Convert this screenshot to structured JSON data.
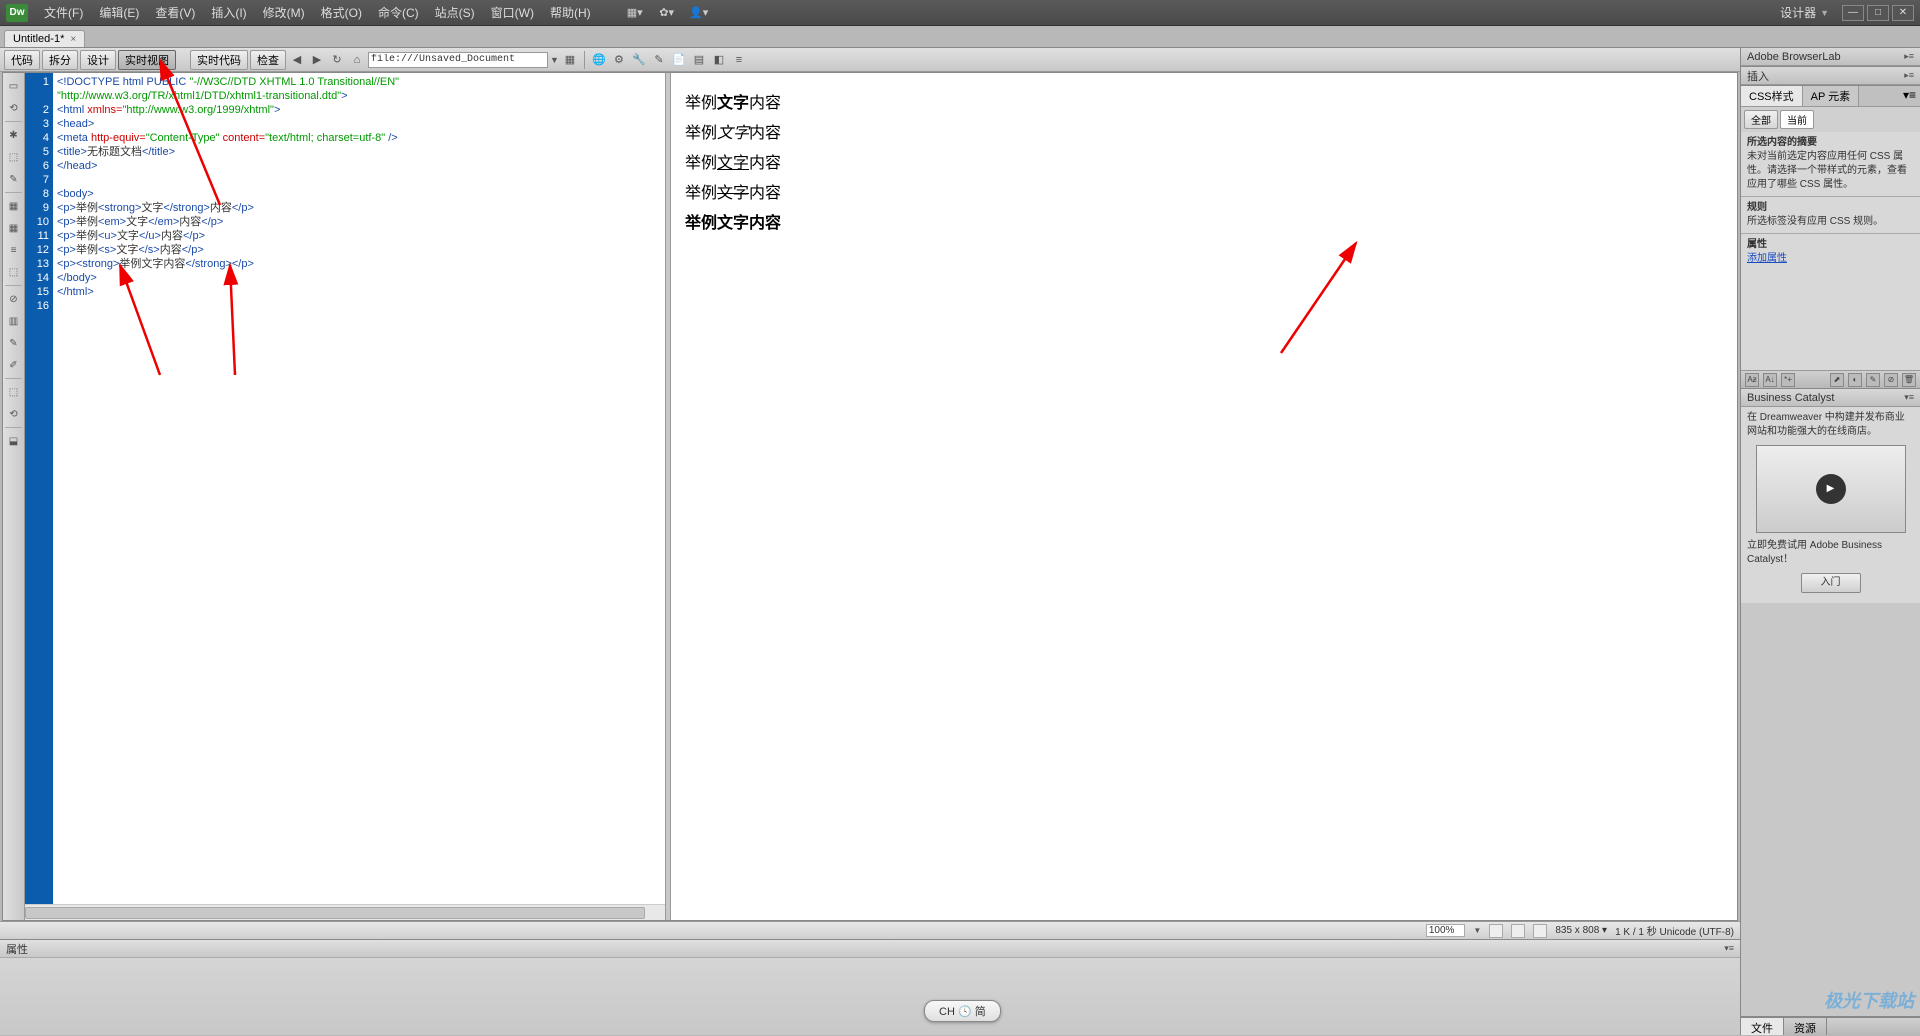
{
  "app": {
    "logo": "Dw"
  },
  "menu": {
    "items": [
      "文件(F)",
      "编辑(E)",
      "查看(V)",
      "插入(I)",
      "修改(M)",
      "格式(O)",
      "命令(C)",
      "站点(S)",
      "窗口(W)",
      "帮助(H)"
    ],
    "right_label": "设计器",
    "tool_dropdowns": [
      "▦▾",
      "✿▾",
      "👤▾"
    ]
  },
  "doctab": {
    "title": "Untitled-1*",
    "close": "×"
  },
  "toolbar": {
    "buttons": [
      "代码",
      "拆分",
      "设计",
      "实时视图"
    ],
    "buttons2": [
      "实时代码",
      "检查"
    ],
    "active_index": 3,
    "nav_icons": [
      "◀",
      "▶",
      "↻",
      "⌂"
    ],
    "address": "file:///Unsaved_Document",
    "right_icons": [
      "▦",
      "🌐",
      "⚙",
      "🔧",
      "✎",
      "📄",
      "▤",
      "◧",
      "≡"
    ]
  },
  "vtools": [
    "▭",
    "⟲",
    "✱",
    "⬚",
    "✎",
    "—",
    "▦",
    "▦",
    "≡",
    "⬚",
    "—",
    "⊘",
    "▥",
    "✎",
    "✐",
    "—",
    "⬚",
    "⟲",
    "—",
    "⬓"
  ],
  "code": {
    "lines": [
      {
        "n": 1,
        "html": "<span class='c-doctype'>&lt;!DOCTYPE html PUBLIC</span> <span class='c-str'>\"-//W3C//DTD XHTML 1.0 Transitional//EN\"</span>"
      },
      {
        "n": 0,
        "html": "<span class='c-str'>\"http://www.w3.org/TR/xhtml1/DTD/xhtml1-transitional.dtd\"</span><span class='c-doctype'>&gt;</span>"
      },
      {
        "n": 2,
        "html": "<span class='c-tag'>&lt;html</span> <span class='c-attr'>xmlns=</span><span class='c-str'>\"http://www.w3.org/1999/xhtml\"</span><span class='c-tag'>&gt;</span>"
      },
      {
        "n": 3,
        "html": "<span class='c-tag'>&lt;head&gt;</span>"
      },
      {
        "n": 4,
        "html": "<span class='c-tag'>&lt;meta</span> <span class='c-attr'>http-equiv=</span><span class='c-str'>\"Content-Type\"</span> <span class='c-attr'>content=</span><span class='c-str'>\"text/html; charset=utf-8\"</span> <span class='c-tag'>/&gt;</span>"
      },
      {
        "n": 5,
        "html": "<span class='c-tag'>&lt;title&gt;</span>无标题文档<span class='c-tag'>&lt;/title&gt;</span>"
      },
      {
        "n": 6,
        "html": "<span class='c-tag'>&lt;/head&gt;</span>"
      },
      {
        "n": 7,
        "html": ""
      },
      {
        "n": 8,
        "html": "<span class='c-tag'>&lt;body&gt;</span>"
      },
      {
        "n": 9,
        "html": "<span class='c-tag'>&lt;p&gt;</span>举例<span class='c-tag'>&lt;strong&gt;</span>文字<span class='c-tag'>&lt;/strong&gt;</span>内容<span class='c-tag'>&lt;/p&gt;</span>"
      },
      {
        "n": 10,
        "html": "<span class='c-tag'>&lt;p&gt;</span>举例<span class='c-tag'>&lt;em&gt;</span>文字<span class='c-tag'>&lt;/em&gt;</span>内容<span class='c-tag'>&lt;/p&gt;</span>"
      },
      {
        "n": 11,
        "html": "<span class='c-tag'>&lt;p&gt;</span>举例<span class='c-tag'>&lt;u&gt;</span>文字<span class='c-tag'>&lt;/u&gt;</span>内容<span class='c-tag'>&lt;/p&gt;</span>"
      },
      {
        "n": 12,
        "html": "<span class='c-tag'>&lt;p&gt;</span>举例<span class='c-tag'>&lt;s&gt;</span>文字<span class='c-tag'>&lt;/s&gt;</span>内容<span class='c-tag'>&lt;/p&gt;</span>"
      },
      {
        "n": 13,
        "html": "<span class='c-tag'>&lt;p&gt;&lt;strong&gt;</span>举例文字内容<span class='c-tag'>&lt;/strong&gt;&lt;/p&gt;</span>"
      },
      {
        "n": 14,
        "html": "<span class='c-tag'>&lt;/body&gt;</span>"
      },
      {
        "n": 15,
        "html": "<span class='c-tag'>&lt;/html&gt;</span>"
      },
      {
        "n": 16,
        "html": ""
      }
    ]
  },
  "preview": {
    "p1_a": "举例",
    "p1_b": "文字",
    "p1_c": "内容",
    "p2_a": "举例",
    "p2_b": "文字",
    "p2_c": "内容",
    "p3_a": "举例",
    "p3_b": "文字",
    "p3_c": "内容",
    "p4_a": "举例",
    "p4_b": "文字",
    "p4_c": "内容",
    "p5": "举例文字内容"
  },
  "status": {
    "zoom": "100%",
    "size": "835 x 808 ▾",
    "info": "1 K / 1 秒 Unicode (UTF-8)"
  },
  "props": {
    "title": "属性"
  },
  "ime": {
    "text": "CH 🕓 简"
  },
  "panels": {
    "browserlab": "Adobe BrowserLab",
    "insert": "插入",
    "css": {
      "tab1": "CSS样式",
      "tab2": "AP 元素",
      "btn_all": "全部",
      "btn_cur": "当前",
      "summary_title": "所选内容的摘要",
      "summary_text": "未对当前选定内容应用任何 CSS 属性。请选择一个带样式的元素，查看应用了哪些 CSS 属性。",
      "rules_title": "规则",
      "rules_text": "所选标签没有应用 CSS 规则。",
      "props_title": "属性",
      "props_link": "添加属性"
    },
    "bc": {
      "title": "Business Catalyst",
      "text": "在 Dreamweaver 中构建并发布商业网站和功能强大的在线商店。",
      "footer": "立即免费试用 Adobe Business Catalyst！",
      "btn": "入门"
    },
    "bottom": {
      "tab1": "文件",
      "tab2": "资源"
    }
  },
  "watermark": "极光下载站"
}
